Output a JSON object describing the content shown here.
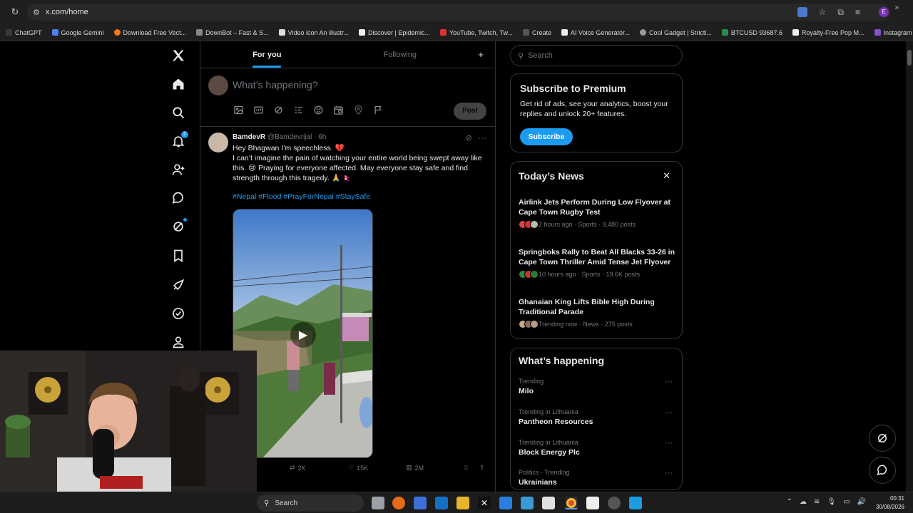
{
  "browser": {
    "url": "x.com/home",
    "bookmarks": [
      "ChatGPT",
      "Google Gemini",
      "Download Free Vect...",
      "DownBot – Fast & S...",
      "Video icon An illustr...",
      "Discover | Epidemic...",
      "YouTube, Twitch, Tw...",
      "Create",
      "AI Voice Generator...",
      "Cool Gadget | Strictl...",
      "BTCUSD 93687.6",
      "Royalty-Free Pop M...",
      "Instagram Videos D..."
    ],
    "profile_initial": "E"
  },
  "nav": {
    "notifications_count": "2"
  },
  "tabs": {
    "for_you": "For you",
    "following": "Following",
    "add": "+"
  },
  "composer": {
    "placeholder": "What’s happening?",
    "post_label": "Post"
  },
  "tweet": {
    "name": "BamdevR",
    "handle": "@Bamdevrijal · 6h",
    "line1": "Hey Bhagwan I’m speechless. 💔",
    "line2": "I can’t imagine the pain of watching your entire world being swept away like this. 😢 Praying for everyone affected. May everyone stay safe and find strength through this tragedy. 🙏 🇳🇵",
    "hashtags": "#Nepal #Flood #PrayForNepal #StaySafe",
    "retweets": "2K",
    "likes": "15K",
    "views": "2M"
  },
  "search": {
    "placeholder": "Search"
  },
  "premium": {
    "title": "Subscribe to Premium",
    "text": "Get rid of ads, see your analytics, boost your replies and unlock 20+ features.",
    "button": "Subscribe"
  },
  "news": {
    "title": "Today’s News",
    "items": [
      {
        "title": "Airlink Jets Perform During Low Flyover at Cape Town Rugby Test",
        "meta": "2 hours ago · Sports · 9,480 posts"
      },
      {
        "title": "Springboks Rally to Beat All Blacks 33-26 in Cape Town Thriller Amid Tense Jet Flyover",
        "meta": "10 hours ago · Sports · 19.6K posts"
      },
      {
        "title": "Ghanaian King Lifts Bible High During Traditional Parade",
        "meta": "Trending now · News · 275 posts"
      }
    ]
  },
  "happening": {
    "title": "What’s happening",
    "trends": [
      {
        "context": "Trending",
        "topic": "Milo"
      },
      {
        "context": "Trending in Lithuania",
        "topic": "Pantheon Resources"
      },
      {
        "context": "Trending in Lithuania",
        "topic": "Block Energy Plc"
      },
      {
        "context": "Politics · Trending",
        "topic": "Ukrainians"
      }
    ]
  },
  "taskbar": {
    "search": "Search",
    "time": "00:31",
    "date": "30/08/2026"
  }
}
